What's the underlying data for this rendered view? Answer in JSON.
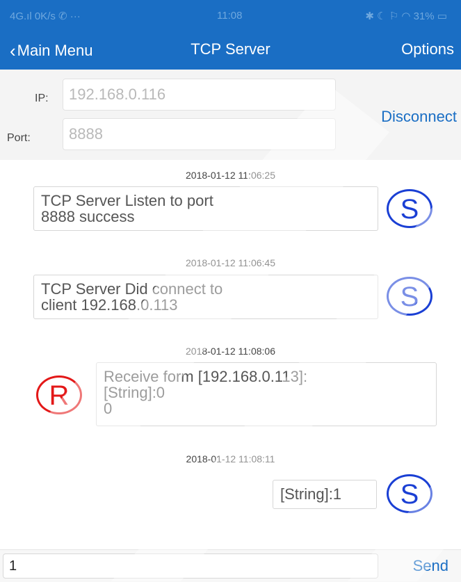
{
  "status_bar": {
    "left": "4G.ıl  0K/s ✆ ···",
    "time": "11:08",
    "right": "✱ ☾ ⚐ ◠ 31% ▭"
  },
  "nav": {
    "back_label": "Main Menu",
    "title": "TCP Server",
    "options_label": "Options"
  },
  "config": {
    "ip_label": "IP:",
    "ip_value": "192.168.0.116",
    "port_label": "Port:",
    "port_value": "8888",
    "disconnect_label": "Disconnect"
  },
  "messages": [
    {
      "timestamp": "2018-01-12 11:06:25",
      "side": "S",
      "lines": [
        "TCP Server Listen to port",
        "8888 success"
      ]
    },
    {
      "timestamp": "2018-01-12 11:06:45",
      "side": "S",
      "lines": [
        "TCP Server Did connect to",
        "client 192.168.0.113"
      ]
    },
    {
      "timestamp": "2018-01-12 11:08:06",
      "side": "R",
      "lines": [
        "Receive form [192.168.0.113]:",
        "[String]:0",
        "0"
      ]
    },
    {
      "timestamp": "2018-01-12 11:08:11",
      "side": "S",
      "lines": [
        "[String]:1"
      ]
    }
  ],
  "input_bar": {
    "value": "1",
    "send_label": "Send"
  },
  "colors": {
    "accent": "#1a6ec4",
    "server_avatar": "#1a3fd4",
    "receive_avatar": "#e31818"
  }
}
